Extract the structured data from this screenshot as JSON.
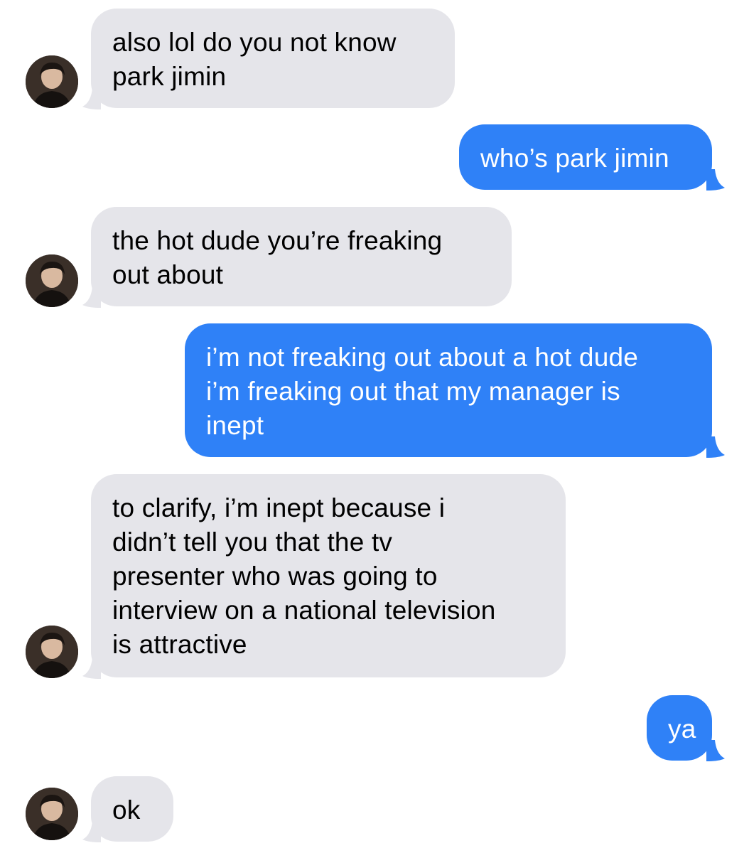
{
  "colors": {
    "incoming_bubble": "#e5e5ea",
    "outgoing_bubble": "#2f81f7",
    "incoming_text": "#000000",
    "outgoing_text": "#ffffff"
  },
  "avatar_icon": "contact-photo-icon",
  "messages": [
    {
      "direction": "incoming",
      "lines": [
        "also lol do you not know",
        "park jimin"
      ]
    },
    {
      "direction": "outgoing",
      "lines": [
        "who’s park jimin"
      ]
    },
    {
      "direction": "incoming",
      "lines": [
        "the hot dude you’re freaking",
        "out about"
      ]
    },
    {
      "direction": "outgoing",
      "lines": [
        "i’m not freaking out about a hot dude",
        "i’m freaking out that my manager is",
        "inept"
      ]
    },
    {
      "direction": "incoming",
      "lines": [
        "to clarify, i’m inept because i",
        "didn’t tell you that the tv",
        "presenter who was going to",
        "interview on a national television",
        "is attractive"
      ]
    },
    {
      "direction": "outgoing",
      "lines": [
        "ya"
      ]
    },
    {
      "direction": "incoming",
      "lines": [
        "ok"
      ]
    }
  ]
}
